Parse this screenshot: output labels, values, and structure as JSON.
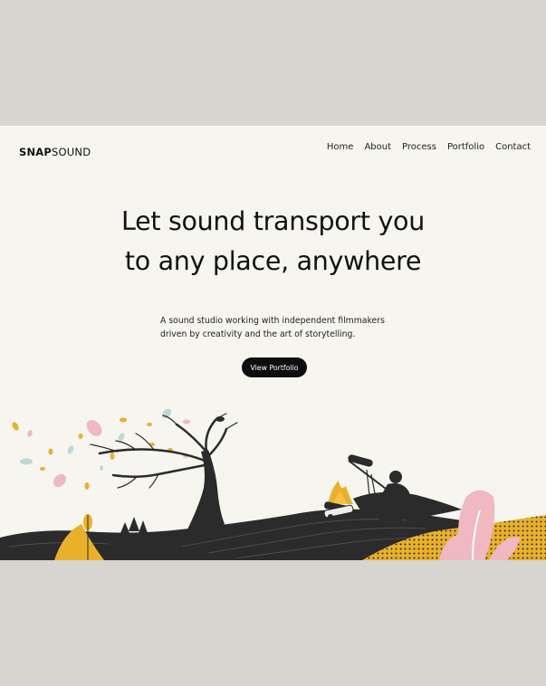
{
  "header": {
    "logo_bold": "SNAP",
    "logo_light": "SOUND",
    "nav": [
      "Home",
      "About",
      "Process",
      "Portfolio",
      "Contact"
    ]
  },
  "hero": {
    "title_line1": "Let sound transport you",
    "title_line2": "to any place, anywhere",
    "subtitle_line1": "A sound studio working with independent filmmakers",
    "subtitle_line2": "driven by creativity and the art of storytelling.",
    "cta_label": "View Portfolio"
  },
  "colors": {
    "background": "#f6f5ef",
    "outer": "#d6d5cf",
    "ink": "#2b2b2b",
    "mustard": "#e9b12b",
    "pink": "#f0b8c0",
    "teal": "#bcd9d8"
  },
  "icons": [
    "tree-illustration",
    "campfire-illustration",
    "sound-recordist-illustration",
    "plant-illustration"
  ]
}
